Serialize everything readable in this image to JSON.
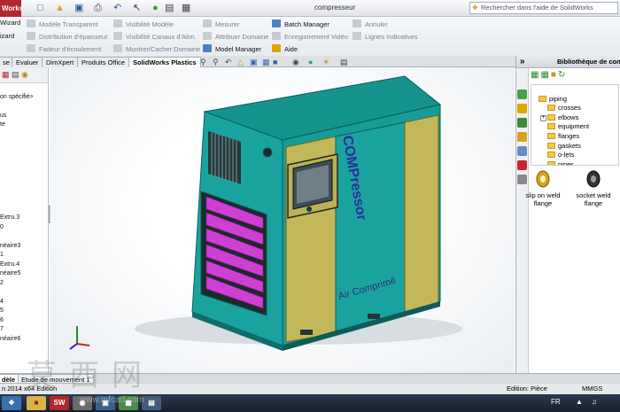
{
  "app": {
    "logo": "Works",
    "document_title": "compresseur",
    "help_placeholder": "Rechercher dans l'aide de SolidWorks"
  },
  "ribbon": {
    "left_labels": [
      "Wizard",
      "izard"
    ],
    "col1": [
      "Modèle Transparent",
      "Distribution d'épaisseur",
      "Fadeur d'écoulement"
    ],
    "col2": [
      "Visibilité Modèle",
      "Visibilité Canaux d'Alim.",
      "Montrer/Cacher Domaine"
    ],
    "col3": [
      "Mesurer",
      "Attribuer Domaine",
      "Model Manager"
    ],
    "col4": [
      "Batch Manager",
      "Enregistrement Vidéo",
      "Aide"
    ],
    "col5": [
      "Annuler",
      "Lignes Indicatives"
    ]
  },
  "tabs": [
    "se",
    "Evaluer",
    "DimXpert",
    "Produits Office",
    "SolidWorks Plastics"
  ],
  "active_tab": "SolidWorks Plastics",
  "tree": {
    "items": [
      "",
      "on spécifié>",
      "",
      "us",
      "te",
      "",
      "",
      "",
      "",
      "",
      "",
      "",
      "",
      "",
      "Extru.3",
      "0",
      "",
      "néaire3",
      "1",
      "Extru.4",
      "néaire5",
      "2",
      "",
      "4",
      "5",
      "6",
      "7",
      "néaire6"
    ]
  },
  "model": {
    "brand_vertical": "COMPressor",
    "brand_bottom": "Air Comprimé"
  },
  "library": {
    "title": "Bibliothèque de conc",
    "tree_root": "piping",
    "tree_items": [
      "crosses",
      "elbows",
      "equipment",
      "flanges",
      "gaskets",
      "o-lets",
      "pipes"
    ],
    "parts": [
      {
        "label": "slip on weld flange"
      },
      {
        "label": "socket weld flange"
      }
    ]
  },
  "bottom_tabs": [
    "dèle",
    "Etude de mouvement 1"
  ],
  "status": {
    "left": "n 2014 x64 Edition",
    "mode": "Edition: Pièce",
    "units": "MMGS"
  },
  "taskbar": {
    "lang": "FR"
  },
  "watermark": {
    "text": "莫西网",
    "small": "www.mfcad.com"
  },
  "colors": {
    "teal": "#189c97",
    "khaki": "#c2b85a",
    "purple": "#d13ed4",
    "logo_red": "#b3262b"
  }
}
